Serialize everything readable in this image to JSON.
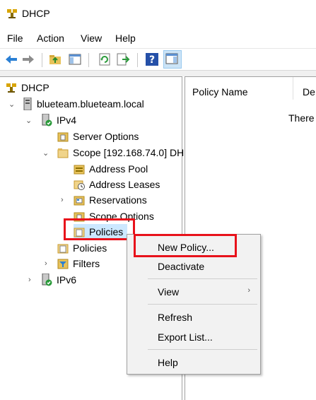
{
  "window": {
    "title": "DHCP"
  },
  "menu": [
    "File",
    "Action",
    "View",
    "Help"
  ],
  "tree": {
    "root": "DHCP",
    "server": "blueteam.blueteam.local",
    "ipv4": "IPv4",
    "server_options": "Server Options",
    "scope": "Scope [192.168.74.0] DH",
    "address_pool": "Address Pool",
    "address_leases": "Address Leases",
    "reservations": "Reservations",
    "scope_options": "Scope Options",
    "scope_policies": "Policies",
    "policies": "Policies",
    "filters": "Filters",
    "ipv6": "IPv6"
  },
  "list": {
    "col_policy_name": "Policy Name",
    "col_desc": "De",
    "empty_text": "There"
  },
  "context_menu": {
    "new_policy": "New Policy...",
    "deactivate": "Deactivate",
    "view": "View",
    "refresh": "Refresh",
    "export_list": "Export List...",
    "help": "Help"
  },
  "colors": {
    "highlight": "#e8121b",
    "selection": "#cce8ff"
  }
}
